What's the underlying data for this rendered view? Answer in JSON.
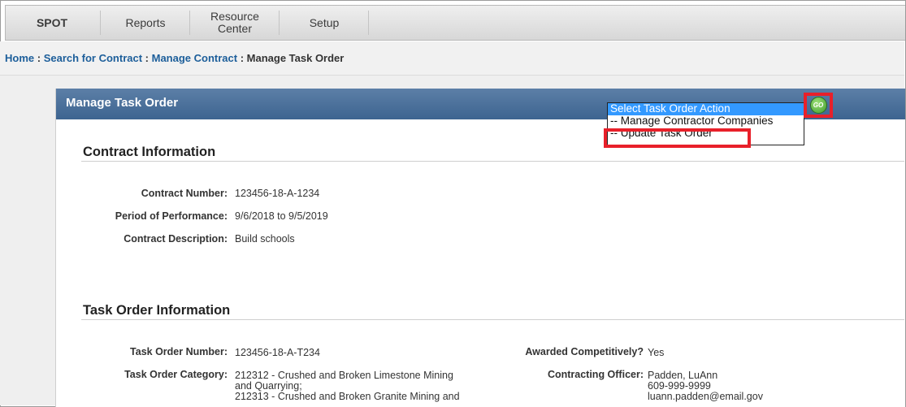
{
  "nav": {
    "spot": "SPOT",
    "reports": "Reports",
    "resource_center": "Resource Center",
    "setup": "Setup"
  },
  "breadcrumb": {
    "home": "Home",
    "search": "Search for Contract",
    "manage_contract": "Manage Contract",
    "current": "Manage Task Order",
    "separator": " : "
  },
  "panel": {
    "title": "Manage Task Order"
  },
  "action_dropdown": {
    "options": [
      "Select Task Order Action",
      "-- Manage Contractor Companies",
      "-- Update Task Order"
    ],
    "selected_index": 0,
    "go_icon_text": "GO",
    "go_icon": "go-icon",
    "highlight_color": "#e8202a"
  },
  "contract_info": {
    "heading": "Contract Information",
    "fields": [
      {
        "label": "Contract Number:",
        "value": "123456-18-A-1234"
      },
      {
        "label": "Period of Performance:",
        "value": "9/6/2018 to 9/5/2019"
      },
      {
        "label": "Contract Description:",
        "value": "Build schools"
      }
    ]
  },
  "task_order_info": {
    "heading": "Task Order Information",
    "left_fields": [
      {
        "label": "Task Order Number:",
        "value": "123456-18-A-T234"
      },
      {
        "label": "Task Order Category:",
        "value_lines": [
          "212312 - Crushed and Broken Limestone Mining",
          "and Quarrying;",
          "212313 - Crushed and Broken Granite Mining and"
        ]
      }
    ],
    "right_fields": [
      {
        "label": "Awarded Competitively?",
        "value": "Yes"
      },
      {
        "label": "Contracting Officer:",
        "value_lines": [
          "Padden, LuAnn",
          "609-999-9999",
          "luann.padden@email.gov"
        ]
      }
    ]
  },
  "colors": {
    "header_blue": "#4a6f9a",
    "link_blue": "#1c5e9a",
    "select_blue": "#3399ff"
  }
}
